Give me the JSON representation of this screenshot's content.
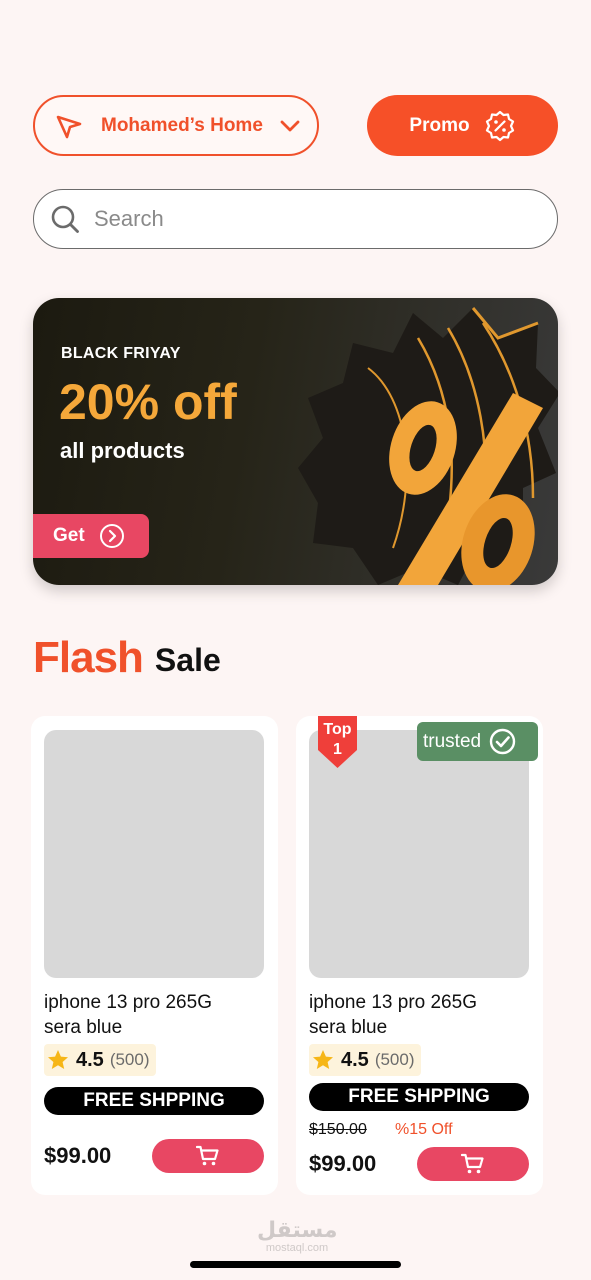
{
  "header": {
    "location_label": "Mohamed’s Home",
    "promo_label": "Promo"
  },
  "search": {
    "placeholder": "Search"
  },
  "banner": {
    "tag": "BLACK FRIYAY",
    "headline": "20% off",
    "subline": "all products",
    "cta_label": "Get"
  },
  "flash_sale": {
    "flash_word": "Flash",
    "sale_word": "Sale"
  },
  "products": [
    {
      "name_line1": "iphone 13 pro 265G",
      "name_line2": "sera blue",
      "rating": "4.5",
      "reviews": "(500)",
      "shipping": "FREE SHPPING",
      "price": "$99.00"
    },
    {
      "name_line1": "iphone 13 pro 265G",
      "name_line2": "sera blue",
      "rating": "4.5",
      "reviews": "(500)",
      "shipping": "FREE SHPPING",
      "old_price": "$150.00",
      "discount": "%15 Off",
      "price": "$99.00",
      "rank_badge_line1": "Top",
      "rank_badge_line2": "1",
      "trusted_label": "trusted"
    }
  ],
  "watermark": {
    "arabic": "مستقل",
    "latin": "mostaql.com"
  },
  "colors": {
    "accent": "#f0512b",
    "promo": "#f65028",
    "cart": "#e84763",
    "banner_text": "#f5a83a",
    "trusted": "#5a8f64",
    "background": "#fdf5f4"
  },
  "icons": {
    "location": "navigation-arrow-icon",
    "dropdown": "chevron-down-icon",
    "promo": "discount-badge-icon",
    "search": "search-icon",
    "get": "chevron-right-circle-icon",
    "rating": "star-icon",
    "cart": "cart-icon",
    "trusted": "check-circle-icon"
  }
}
